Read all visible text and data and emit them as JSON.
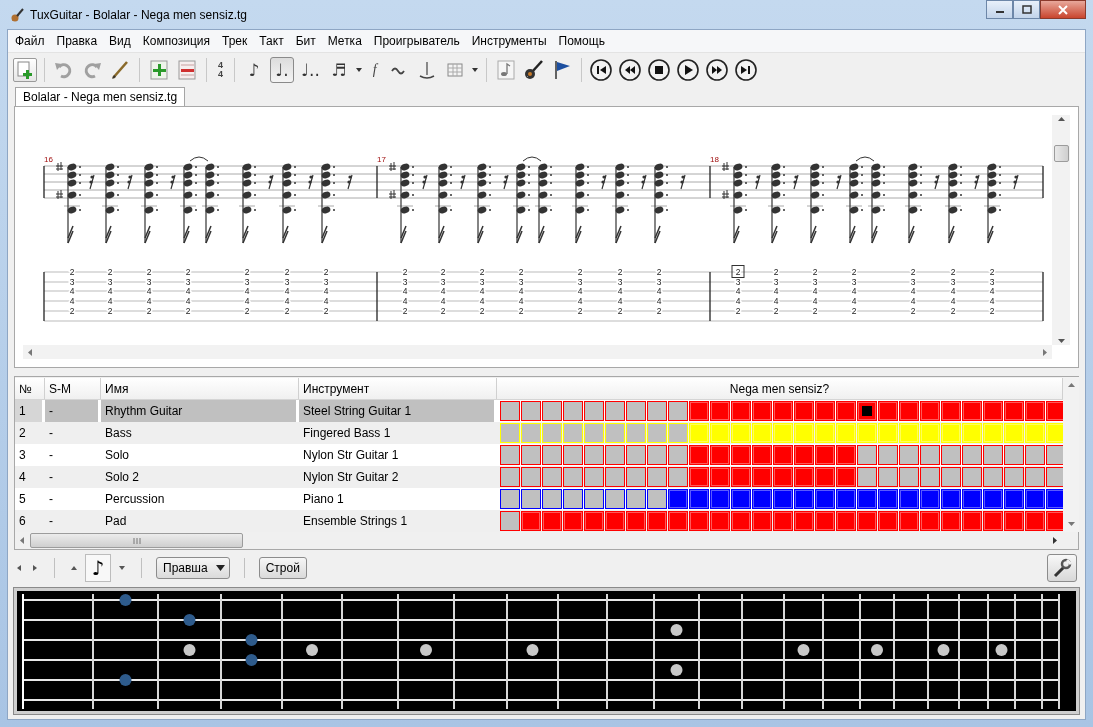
{
  "window": {
    "title": "TuxGuitar - Bolalar - Nega men sensiz.tg"
  },
  "menu": [
    "Файл",
    "Правка",
    "Вид",
    "Композиция",
    "Трек",
    "Такт",
    "Бит",
    "Метка",
    "Проигрыватель",
    "Инструменты",
    "Помощь"
  ],
  "toolbar": {
    "time_signature": [
      "4",
      "4"
    ],
    "durations": [
      {
        "glyph": "♪",
        "selected": false
      },
      {
        "glyph": "♩.",
        "selected": true
      },
      {
        "glyph": "♩..",
        "selected": false
      }
    ],
    "tuplet_glyph": "♬",
    "dynamic_glyph": "f"
  },
  "tabs": [
    {
      "label": "Bolalar - Nega men sensiz.tg",
      "selected": true
    }
  ],
  "score": {
    "measures": [
      {
        "number": "16",
        "beats": [
          {
            "frets": [
              "2",
              "3",
              "4",
              "4",
              "2"
            ],
            "selected": false
          },
          {
            "frets": [
              "2",
              "3",
              "4",
              "4",
              "2"
            ],
            "selected": false
          },
          {
            "frets": [
              "2",
              "3",
              "4",
              "4",
              "2"
            ],
            "selected": false
          },
          {
            "frets": [
              "2",
              "3",
              "4",
              "4",
              "2"
            ],
            "selected": false
          },
          {
            "frets": [
              "2",
              "3",
              "4",
              "4",
              "2"
            ],
            "selected": false
          },
          {
            "frets": [
              "2",
              "3",
              "4",
              "4",
              "2"
            ],
            "selected": false
          },
          {
            "frets": [
              "2",
              "3",
              "4",
              "4",
              "2"
            ],
            "selected": false
          }
        ]
      },
      {
        "number": "17",
        "beats": [
          {
            "frets": [
              "2",
              "3",
              "4",
              "4",
              "2"
            ],
            "selected": false
          },
          {
            "frets": [
              "2",
              "3",
              "4",
              "4",
              "2"
            ],
            "selected": false
          },
          {
            "frets": [
              "2",
              "3",
              "4",
              "4",
              "2"
            ],
            "selected": false
          },
          {
            "frets": [
              "2",
              "3",
              "4",
              "4",
              "2"
            ],
            "selected": false
          },
          {
            "frets": [
              "2",
              "3",
              "4",
              "4",
              "2"
            ],
            "selected": false
          },
          {
            "frets": [
              "2",
              "3",
              "4",
              "4",
              "2"
            ],
            "selected": false
          },
          {
            "frets": [
              "2",
              "3",
              "4",
              "4",
              "2"
            ],
            "selected": false
          }
        ]
      },
      {
        "number": "18",
        "beats": [
          {
            "frets": [
              "2",
              "3",
              "4",
              "4",
              "2"
            ],
            "selected": true
          },
          {
            "frets": [
              "2",
              "3",
              "4",
              "4",
              "2"
            ],
            "selected": false
          },
          {
            "frets": [
              "2",
              "3",
              "4",
              "4",
              "2"
            ],
            "selected": false
          },
          {
            "frets": [
              "2",
              "3",
              "4",
              "4",
              "2"
            ],
            "selected": false
          },
          {
            "frets": [
              "2",
              "3",
              "4",
              "4",
              "2"
            ],
            "selected": false
          },
          {
            "frets": [
              "2",
              "3",
              "4",
              "4",
              "2"
            ],
            "selected": false
          },
          {
            "frets": [
              "2",
              "3",
              "4",
              "4",
              "2"
            ],
            "selected": false
          }
        ]
      }
    ]
  },
  "tracks": {
    "columns": [
      "№",
      "S-M",
      "Имя",
      "Инструмент"
    ],
    "song_title": "Nega men sensiz?",
    "rows": [
      {
        "number": "1",
        "solo_mute": "-",
        "name": "Rhythm Guitar",
        "instrument": "Steel String Guitar 1",
        "color": "#ff0000",
        "selected": true,
        "filled": [
          false,
          false,
          false,
          false,
          false,
          false,
          false,
          false,
          false,
          true,
          true,
          true,
          true,
          true,
          true,
          true,
          true,
          true,
          true,
          true,
          true,
          true,
          true,
          true,
          true,
          true,
          true
        ],
        "cursor": [
          false,
          false,
          false,
          false,
          false,
          false,
          false,
          false,
          false,
          false,
          false,
          false,
          false,
          false,
          false,
          false,
          false,
          true,
          false,
          false,
          false,
          false,
          false,
          false,
          false,
          false,
          false
        ]
      },
      {
        "number": "2",
        "solo_mute": "-",
        "name": "Bass",
        "instrument": "Fingered Bass 1",
        "color": "#ffff00",
        "selected": false,
        "filled": [
          false,
          false,
          false,
          false,
          false,
          false,
          false,
          false,
          false,
          true,
          true,
          true,
          true,
          true,
          true,
          true,
          true,
          true,
          true,
          true,
          true,
          true,
          true,
          true,
          true,
          true,
          true
        ],
        "cursor": [
          false,
          false,
          false,
          false,
          false,
          false,
          false,
          false,
          false,
          false,
          false,
          false,
          false,
          false,
          false,
          false,
          false,
          false,
          false,
          false,
          false,
          false,
          false,
          false,
          false,
          false,
          false
        ]
      },
      {
        "number": "3",
        "solo_mute": "-",
        "name": "Solo",
        "instrument": "Nylon Str Guitar 1",
        "color": "#ff0000",
        "selected": false,
        "filled": [
          false,
          false,
          false,
          false,
          false,
          false,
          false,
          false,
          false,
          true,
          true,
          true,
          true,
          true,
          true,
          true,
          true,
          false,
          false,
          false,
          false,
          false,
          false,
          false,
          false,
          false,
          false
        ],
        "cursor": [
          false,
          false,
          false,
          false,
          false,
          false,
          false,
          false,
          false,
          false,
          false,
          false,
          false,
          false,
          false,
          false,
          false,
          false,
          false,
          false,
          false,
          false,
          false,
          false,
          false,
          false,
          false
        ]
      },
      {
        "number": "4",
        "solo_mute": "-",
        "name": "Solo 2",
        "instrument": "Nylon Str Guitar 2",
        "color": "#ff0000",
        "selected": false,
        "filled": [
          false,
          false,
          false,
          false,
          false,
          false,
          false,
          false,
          false,
          true,
          true,
          true,
          true,
          true,
          true,
          true,
          true,
          false,
          false,
          false,
          false,
          false,
          false,
          false,
          false,
          false,
          false
        ],
        "cursor": [
          false,
          false,
          false,
          false,
          false,
          false,
          false,
          false,
          false,
          false,
          false,
          false,
          false,
          false,
          false,
          false,
          false,
          false,
          false,
          false,
          false,
          false,
          false,
          false,
          false,
          false,
          false
        ]
      },
      {
        "number": "5",
        "solo_mute": "-",
        "name": "Percussion",
        "instrument": "Piano 1",
        "color": "#0000ff",
        "selected": false,
        "filled": [
          false,
          false,
          false,
          false,
          false,
          false,
          false,
          false,
          true,
          true,
          true,
          true,
          true,
          true,
          true,
          true,
          true,
          true,
          true,
          true,
          true,
          true,
          true,
          true,
          true,
          true,
          true
        ],
        "cursor": [
          false,
          false,
          false,
          false,
          false,
          false,
          false,
          false,
          false,
          false,
          false,
          false,
          false,
          false,
          false,
          false,
          false,
          false,
          false,
          false,
          false,
          false,
          false,
          false,
          false,
          false,
          false
        ]
      },
      {
        "number": "6",
        "solo_mute": "-",
        "name": "Pad",
        "instrument": "Ensemble Strings 1",
        "color": "#ff0000",
        "selected": false,
        "filled": [
          false,
          true,
          true,
          true,
          true,
          true,
          true,
          true,
          true,
          true,
          true,
          true,
          true,
          true,
          true,
          true,
          true,
          true,
          true,
          true,
          true,
          true,
          true,
          true,
          true,
          true,
          true
        ],
        "cursor": [
          false,
          false,
          false,
          false,
          false,
          false,
          false,
          false,
          false,
          false,
          false,
          false,
          false,
          false,
          false,
          false,
          false,
          false,
          false,
          false,
          false,
          false,
          false,
          false,
          false,
          false,
          false
        ]
      }
    ]
  },
  "lower_toolbar": {
    "note_glyph": "♪",
    "hand": "Правша",
    "tuning_button": "Строй"
  },
  "fretboard": {
    "strings": [
      {
        "pressed": [
          false,
          true,
          false,
          false,
          false,
          false,
          false,
          false,
          false,
          false,
          false,
          false,
          false,
          false,
          false,
          false,
          false,
          false,
          false,
          false,
          false,
          false
        ]
      },
      {
        "pressed": [
          false,
          false,
          true,
          false,
          false,
          false,
          false,
          false,
          false,
          false,
          false,
          false,
          false,
          false,
          false,
          false,
          false,
          false,
          false,
          false,
          false,
          false
        ]
      },
      {
        "pressed": [
          false,
          false,
          false,
          true,
          false,
          false,
          false,
          false,
          false,
          false,
          false,
          false,
          false,
          false,
          false,
          false,
          false,
          false,
          false,
          false,
          false,
          false
        ]
      },
      {
        "pressed": [
          false,
          false,
          false,
          true,
          false,
          false,
          false,
          false,
          false,
          false,
          false,
          false,
          false,
          false,
          false,
          false,
          false,
          false,
          false,
          false,
          false,
          false
        ]
      },
      {
        "pressed": [
          false,
          true,
          false,
          false,
          false,
          false,
          false,
          false,
          false,
          false,
          false,
          false,
          false,
          false,
          false,
          false,
          false,
          false,
          false,
          false,
          false,
          false
        ]
      },
      {
        "pressed": [
          false,
          false,
          false,
          false,
          false,
          false,
          false,
          false,
          false,
          false,
          false,
          false,
          false,
          false,
          false,
          false,
          false,
          false,
          false,
          false,
          false,
          false
        ]
      }
    ]
  }
}
